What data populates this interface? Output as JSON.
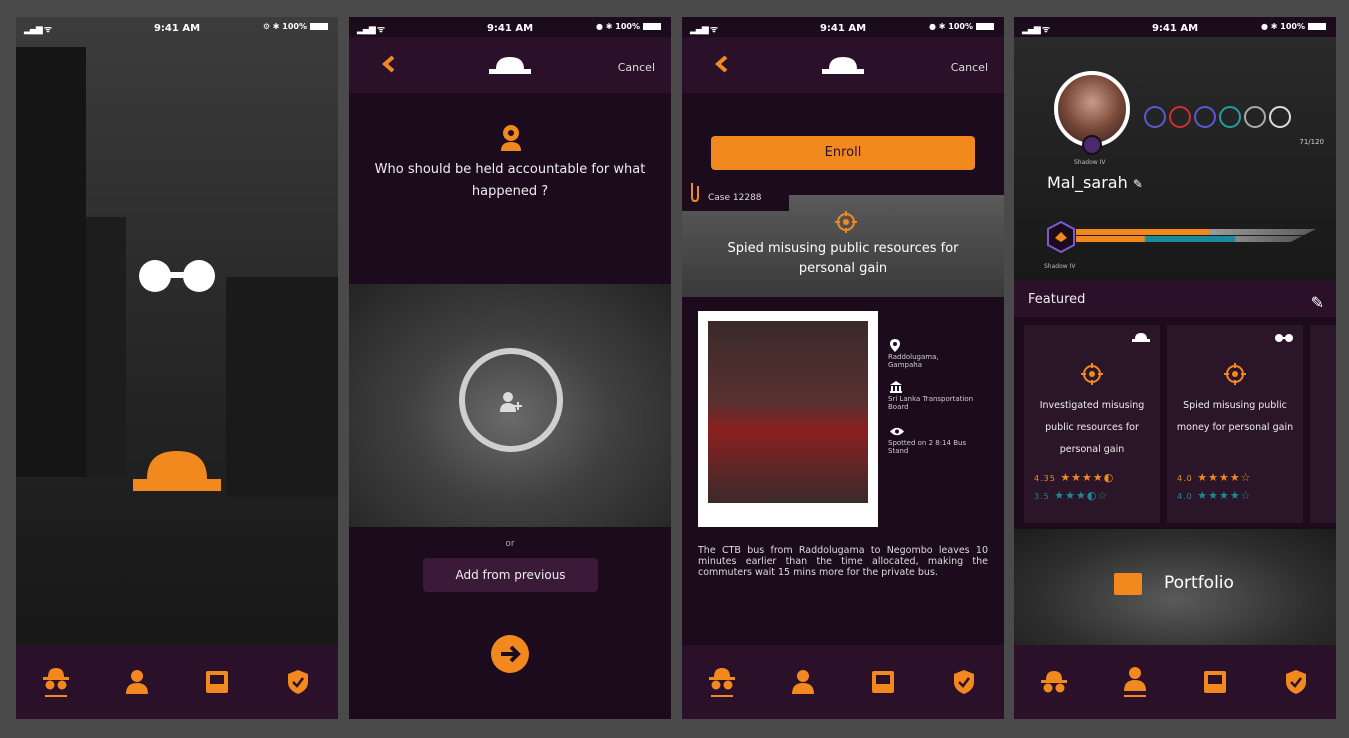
{
  "status": {
    "time_1": "9:41 AM",
    "time_2": "9:41 AM",
    "time_3": "9:41 AM",
    "time_4": "9:41 AM",
    "battery_1": "100%",
    "battery_2": "100%",
    "battery_3": "100%",
    "battery_4": "100%"
  },
  "colors": {
    "accent": "#f2891e",
    "bg": "#1c0b1c",
    "bar": "#2b102a"
  },
  "header": {
    "cancel_label": "Cancel"
  },
  "screen2": {
    "question": "Who should be held accountable for what happened ?",
    "or_label": "or",
    "add_previous": "Add from previous"
  },
  "screen3": {
    "enroll_label": "Enroll",
    "case_label": "Case 12288",
    "banner_title": "Spied misusing public resources for personal gain",
    "location": "Raddolugama, Gampaha",
    "organization": "Sri Lanka Transportation Board",
    "spotted": "Spotted on 2 8:14 Bus Stand",
    "description": "The CTB bus from Raddolugama to Negombo leaves 10 minutes earlier than the time allocated, making the commuters wait 15 mins more for the private bus."
  },
  "screen4": {
    "shadow_label": "Shadow IV",
    "username": "Mal_sarah",
    "score": "71/120",
    "rank_label": "Shadow IV",
    "featured_label": "Featured",
    "portfolio_label": "Portfolio",
    "cards": [
      {
        "title": "Investigated misusing public resources for personal gain",
        "rating_1": "4.35",
        "rating_2": "3.5"
      },
      {
        "title": "Spied misusing public money for personal gain",
        "rating_1": "4.0",
        "rating_2": "4.0"
      }
    ]
  }
}
